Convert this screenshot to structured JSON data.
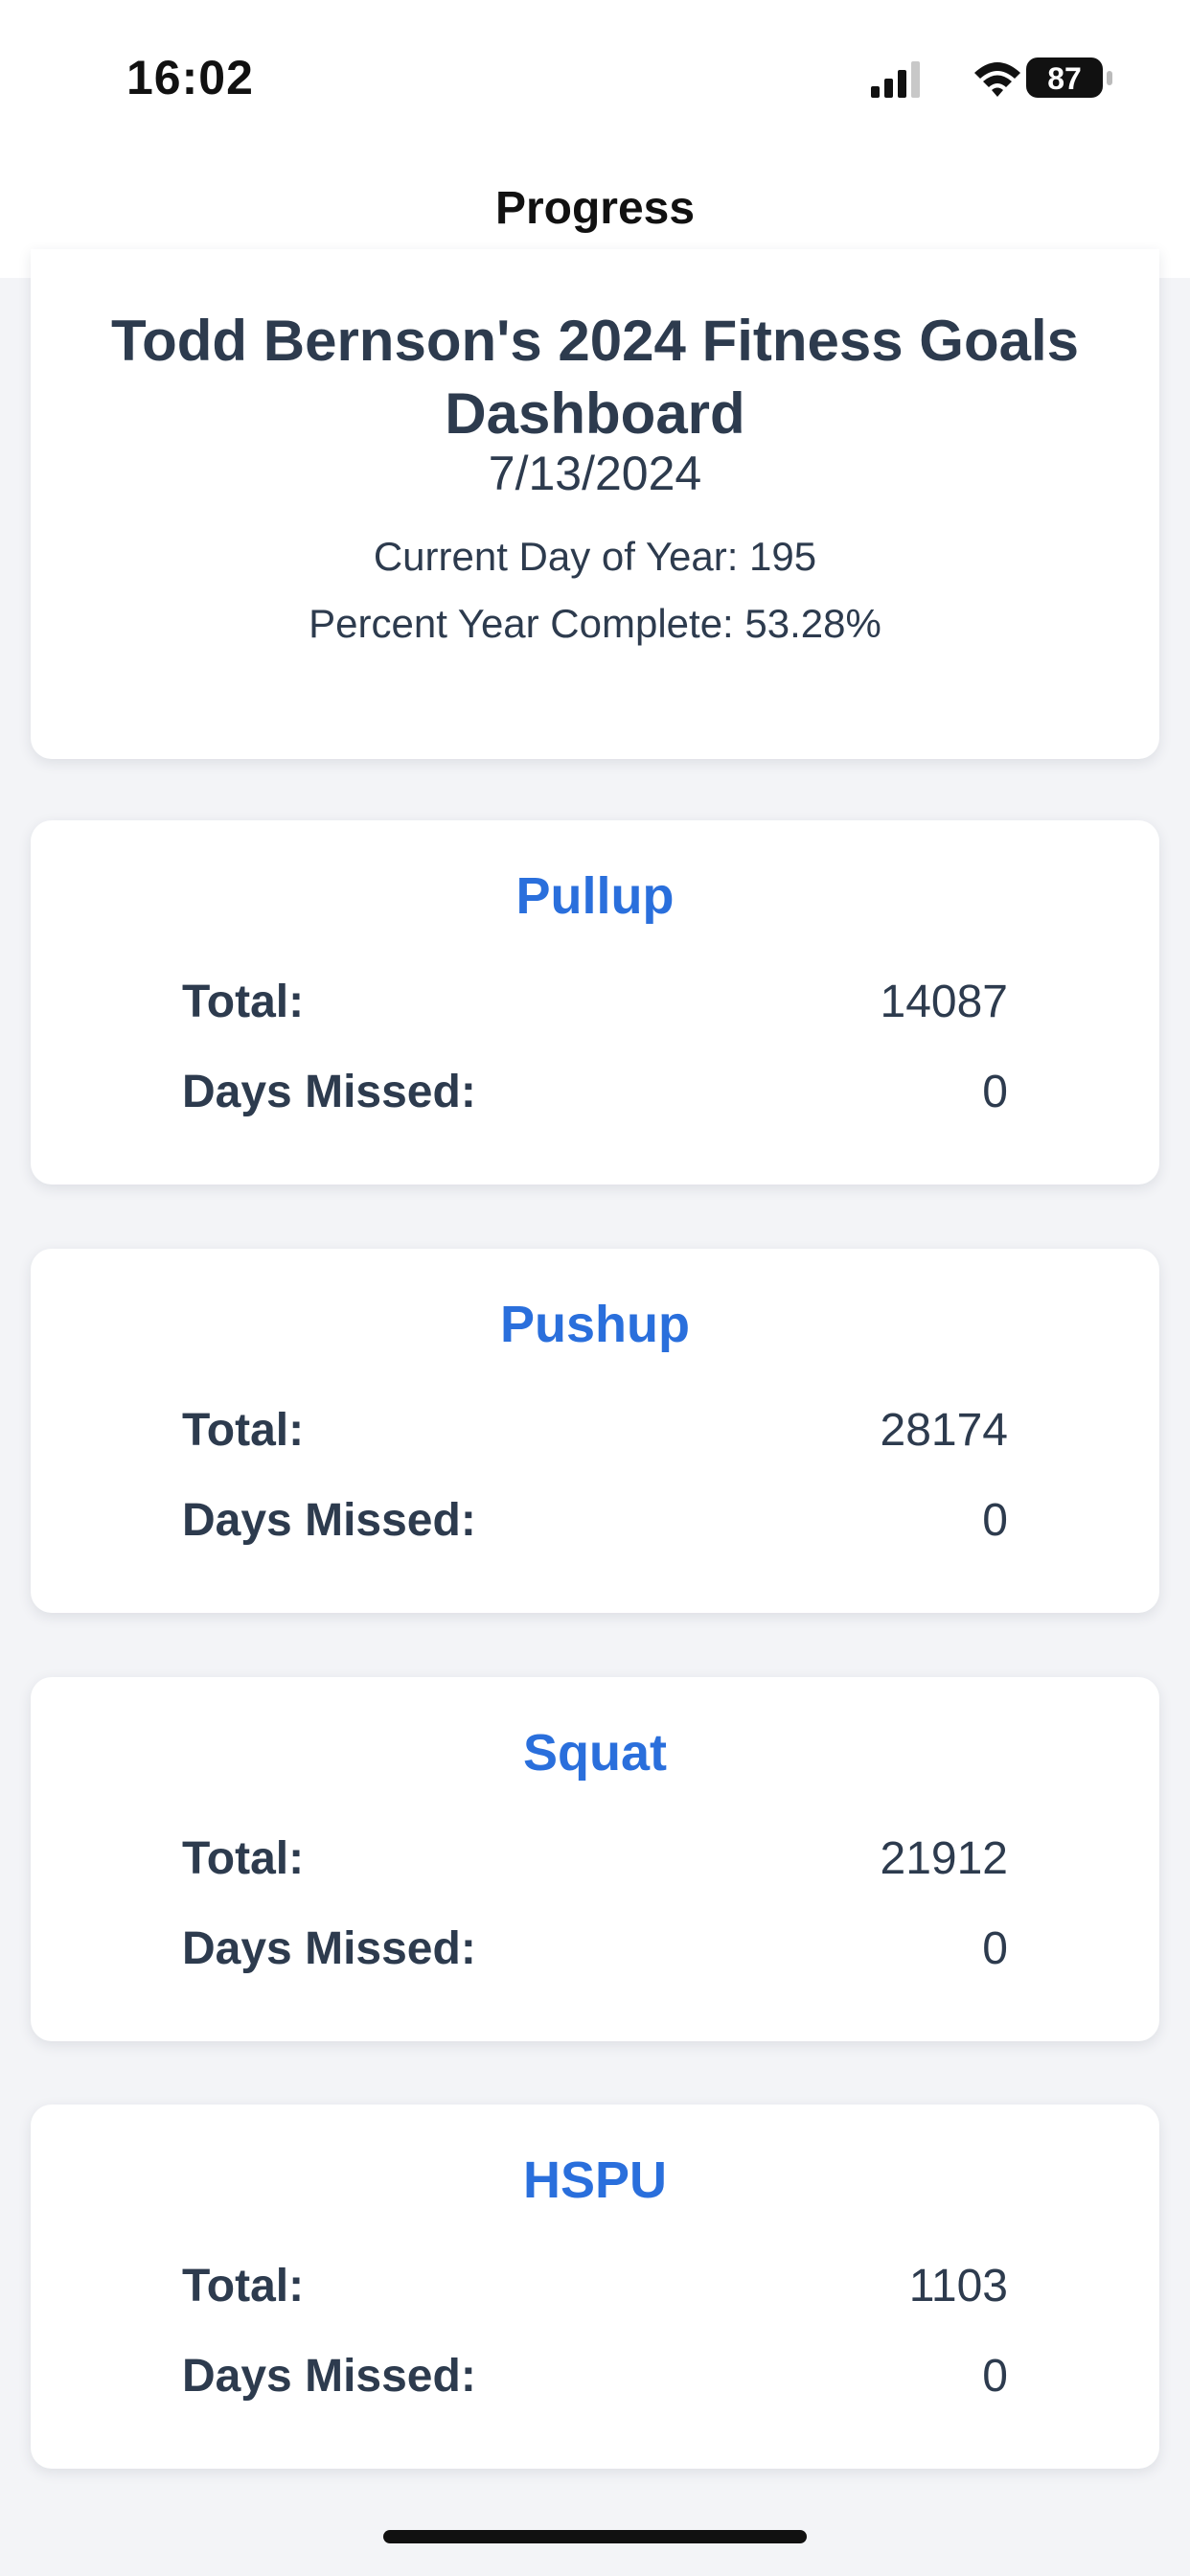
{
  "status_bar": {
    "time": "16:02",
    "battery": "87",
    "icons": [
      "signal-icon",
      "wifi-icon",
      "battery-icon"
    ]
  },
  "nav": {
    "title": "Progress"
  },
  "header": {
    "title": "Todd Bernson's 2024 Fitness Goals Dashboard",
    "date": "7/13/2024",
    "day_of_year": "Current Day of Year: 195",
    "percent_complete": "Percent Year Complete: 53.28%"
  },
  "exercises": [
    {
      "name": "Pullup",
      "total_label": "Total:",
      "total": "14087",
      "missed_label": "Days Missed:",
      "missed": "0"
    },
    {
      "name": "Pushup",
      "total_label": "Total:",
      "total": "28174",
      "missed_label": "Days Missed:",
      "missed": "0"
    },
    {
      "name": "Squat",
      "total_label": "Total:",
      "total": "21912",
      "missed_label": "Days Missed:",
      "missed": "0"
    },
    {
      "name": "HSPU",
      "total_label": "Total:",
      "total": "1103",
      "missed_label": "Days Missed:",
      "missed": "0"
    }
  ],
  "colors": {
    "accent": "#2a6fdc",
    "text": "#2d3b4e",
    "background": "#f3f4f7",
    "card": "#ffffff"
  }
}
